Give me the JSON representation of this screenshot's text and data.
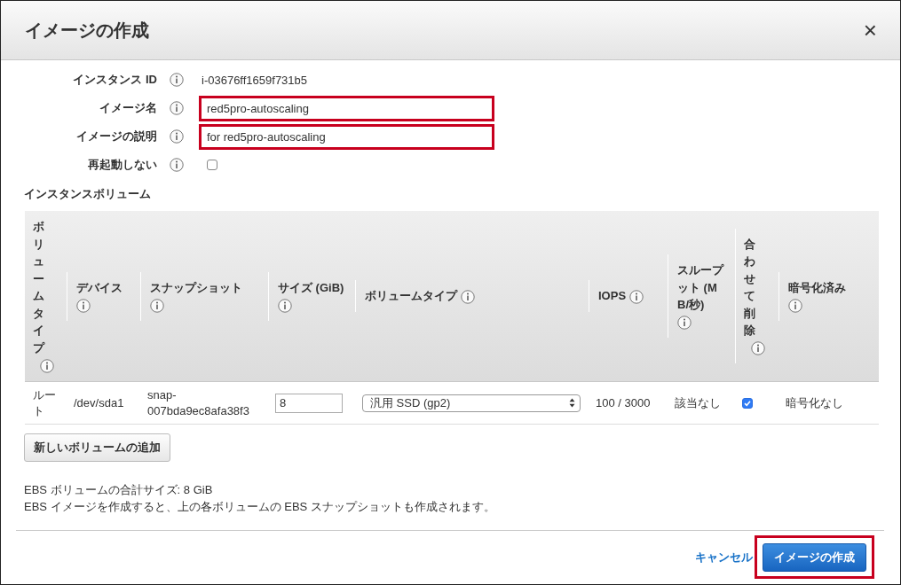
{
  "dialog": {
    "title": "イメージの作成",
    "close_glyph": "×"
  },
  "form": [
    {
      "label": "インスタンス ID",
      "kind": "text",
      "value": "i-03676ff1659f731b5"
    },
    {
      "label": "イメージ名",
      "kind": "input",
      "value": "red5pro-autoscaling",
      "highlighted": true
    },
    {
      "label": "イメージの説明",
      "kind": "input",
      "value": "for red5pro-autoscaling",
      "highlighted": true
    },
    {
      "label": "再起動しない",
      "kind": "checkbox",
      "checked": false
    }
  ],
  "volumes": {
    "title": "インスタンスボリューム",
    "columns": [
      "ボリュームタイプ",
      "デバイス",
      "スナップショット",
      "サイズ (GiB)",
      "ボリュームタイプ",
      "IOPS",
      "スループット (MB/秒)",
      "合わせて削除",
      "暗号化済み"
    ],
    "rows": [
      {
        "cells": [
          {
            "kind": "text",
            "value": "ルート"
          },
          {
            "kind": "text",
            "value": "/dev/sda1"
          },
          {
            "kind": "text",
            "value": "snap-007bda9ec8afa38f3"
          },
          {
            "kind": "input",
            "value": "8"
          },
          {
            "kind": "select",
            "value": "汎用 SSD (gp2)"
          },
          {
            "kind": "text",
            "value": "100 / 3000"
          },
          {
            "kind": "text",
            "value": "該当なし"
          },
          {
            "kind": "checkbox",
            "checked": true
          },
          {
            "kind": "text",
            "value": "暗号化なし"
          }
        ]
      }
    ]
  },
  "add_volume_button": "新しいボリュームの追加",
  "summary": [
    "EBS ボリュームの合計サイズ: 8 GiB",
    "EBS イメージを作成すると、上の各ボリュームの EBS スナップショットも作成されます。"
  ],
  "footer": {
    "cancel_link": "キャンセル",
    "create_button": {
      "label": "イメージの作成",
      "highlighted": true
    }
  }
}
